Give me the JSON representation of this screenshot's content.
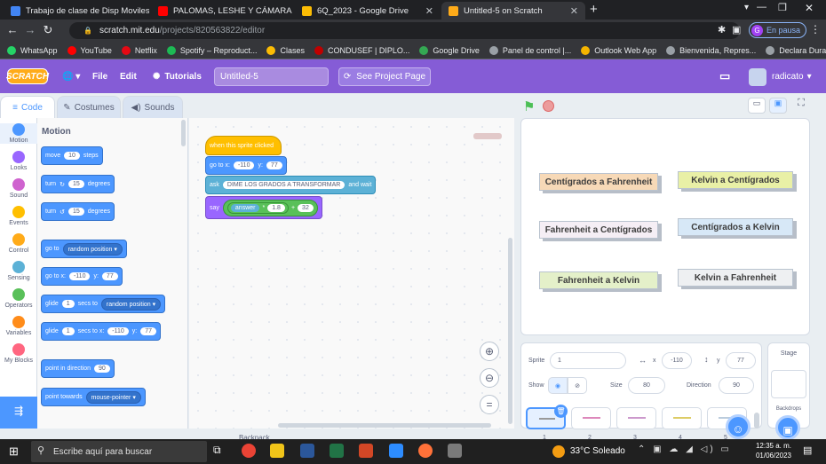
{
  "browser": {
    "tabs": [
      {
        "title": "Trabajo de clase de Disp Moviles",
        "color": "#4285f4"
      },
      {
        "title": "PALOMAS, LESHE Y CÁMARA",
        "color": "#ff0000"
      },
      {
        "title": "6Q_2023 - Google Drive",
        "color": "#fbbc04"
      },
      {
        "title": "Untitled-5 on Scratch",
        "color": "#ffab19"
      }
    ],
    "url_host": "scratch.mit.edu",
    "url_path": "/projects/820563822/editor",
    "profile_initial": "G",
    "profile_status": "En pausa",
    "bookmarks": [
      {
        "label": "WhatsApp",
        "color": "#25d366"
      },
      {
        "label": "YouTube",
        "color": "#ff0000"
      },
      {
        "label": "Netflix",
        "color": "#e50914"
      },
      {
        "label": "Spotify – Reproduct...",
        "color": "#1db954"
      },
      {
        "label": "Clases",
        "color": "#fbbc04"
      },
      {
        "label": "CONDUSEF | DIPLO...",
        "color": "#c00000"
      },
      {
        "label": "Google Drive",
        "color": "#34a853"
      },
      {
        "label": "Panel de control |...",
        "color": "#9aa0a6"
      },
      {
        "label": "Outlook Web App",
        "color": "#f4b400"
      },
      {
        "label": "Bienvenida, Repres...",
        "color": "#9aa0a6"
      },
      {
        "label": "Declara Durango",
        "color": "#9aa0a6"
      }
    ]
  },
  "menu": {
    "logo": "SCRATCH",
    "file": "File",
    "edit": "Edit",
    "tutorials": "Tutorials",
    "project_title": "Untitled-5",
    "see_project": "See Project Page",
    "username": "radicato"
  },
  "editor_tabs": {
    "code": "Code",
    "costumes": "Costumes",
    "sounds": "Sounds"
  },
  "categories": [
    {
      "label": "Motion",
      "color": "#4c97ff"
    },
    {
      "label": "Looks",
      "color": "#9966ff"
    },
    {
      "label": "Sound",
      "color": "#cf63cf"
    },
    {
      "label": "Events",
      "color": "#ffbf00"
    },
    {
      "label": "Control",
      "color": "#ffab19"
    },
    {
      "label": "Sensing",
      "color": "#5cb1d6"
    },
    {
      "label": "Operators",
      "color": "#59c059"
    },
    {
      "label": "Variables",
      "color": "#ff8c1a"
    },
    {
      "label": "My Blocks",
      "color": "#ff6680"
    }
  ],
  "palette": {
    "heading": "Motion",
    "move": {
      "a": "move",
      "v": "10",
      "b": "steps"
    },
    "turn_right": {
      "a": "turn",
      "v": "15",
      "b": "degrees"
    },
    "turn_left": {
      "a": "turn",
      "v": "15",
      "b": "degrees"
    },
    "goto_random": {
      "a": "go to",
      "dd": "random position"
    },
    "goto_xy": {
      "a": "go to x:",
      "x": "-110",
      "y_label": "y:",
      "y": "77"
    },
    "glide_random": {
      "a": "glide",
      "v": "1",
      "b": "secs to",
      "dd": "random position"
    },
    "glide_xy": {
      "a": "glide",
      "v": "1",
      "b": "secs to x:",
      "x": "-110",
      "y_label": "y:",
      "y": "77"
    },
    "point_dir": {
      "a": "point in direction",
      "v": "90"
    },
    "point_towards": {
      "a": "point towards",
      "dd": "mouse-pointer"
    }
  },
  "script": {
    "hat": "when this sprite clicked",
    "goto": {
      "a": "go to x:",
      "x": "-110",
      "y_label": "y:",
      "y": "77"
    },
    "ask": {
      "a": "ask",
      "v": "DIME LOS GRADOS A TRANSFORMAR",
      "b": "and wait"
    },
    "say": {
      "a": "say",
      "answer": "answer",
      "times": "*",
      "mult": "1.8",
      "plus": "+",
      "add": "32"
    },
    "comment": "Backpack"
  },
  "stage_cards": [
    {
      "label": "Centígrados a Fahrenheit",
      "bg": "#f7d9b7"
    },
    {
      "label": "Kelvin a Centígrados",
      "bg": "#e9f0a6"
    },
    {
      "label": "Fahrenheit a Centígrados",
      "bg": "#f5eef5"
    },
    {
      "label": "Centígrados a Kelvin",
      "bg": "#d7e8f7"
    },
    {
      "label": "Fahrenheit a Kelvin",
      "bg": "#e4f0c9"
    },
    {
      "label": "Kelvin a Fahrenheit",
      "bg": "#eef0f2"
    }
  ],
  "sprite_info": {
    "sprite_label": "Sprite",
    "sprite_name": "1",
    "x_label": "x",
    "x": "-110",
    "y_label": "y",
    "y": "77",
    "show_label": "Show",
    "size_label": "Size",
    "size": "80",
    "direction_label": "Direction",
    "direction": "90",
    "sprite_numbers": [
      "1",
      "2",
      "3",
      "4",
      "5"
    ]
  },
  "stage_panel": {
    "label": "Stage",
    "backdrops": "Backdrops"
  },
  "taskbar": {
    "search": "Escribe aquí para buscar",
    "weather": "33°C  Soleado",
    "time": "12:35 a. m.",
    "date": "01/06/2023"
  }
}
